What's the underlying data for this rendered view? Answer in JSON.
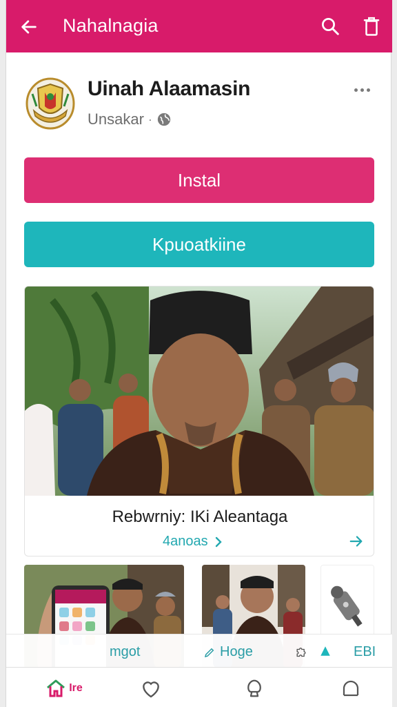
{
  "appbar": {
    "title": "Nahalnagia",
    "back_icon": "arrow-left-icon",
    "search_icon": "search-icon",
    "trash_icon": "trash-icon",
    "color": "#d81b6a"
  },
  "app": {
    "name": "Uinah Alaamasin",
    "publisher": "Unsakar",
    "separator": "·",
    "globe_icon": "globe-icon",
    "more_icon": "more-horizontal-icon",
    "logo": "emblem-logo"
  },
  "buttons": {
    "install": "Instal",
    "secondary": "Kpuoatkiine",
    "install_color": "#dd2e73",
    "secondary_color": "#1eb6bb"
  },
  "feature": {
    "title": "Rebwrniy: IKi Aleantaga",
    "link": "4anoas",
    "chevron_icon": "chevron-right-icon",
    "arrow_icon": "send-arrow-icon"
  },
  "tabs": [
    {
      "label": "mgot"
    },
    {
      "label": "Hoge",
      "icon": "pen-icon"
    },
    {
      "label": "",
      "icon": "puzzle-icon"
    },
    {
      "label": "ЕBI"
    }
  ],
  "bottom_nav": {
    "home_label": "Ire",
    "home_icon": "home-icon",
    "fav_icon": "heart-icon",
    "shop_icon": "bag-icon",
    "profile_icon": "profile-icon"
  }
}
